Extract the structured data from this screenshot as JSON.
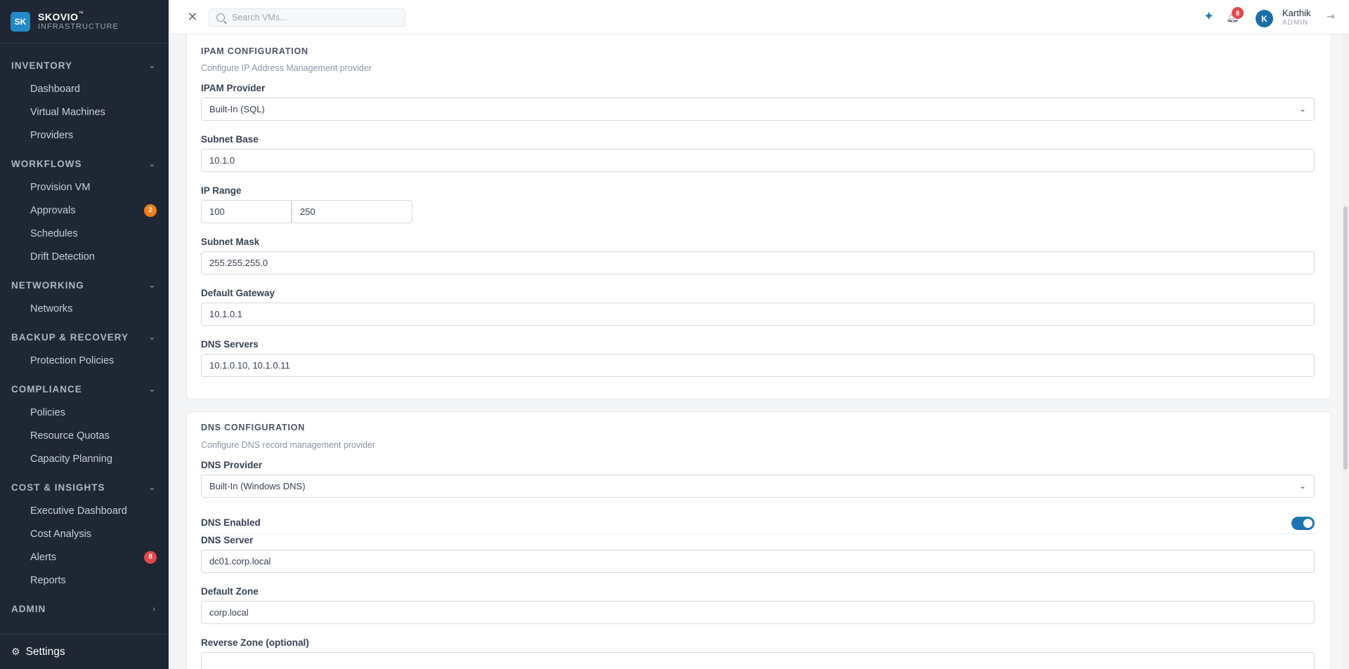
{
  "brand": {
    "logo": "SK",
    "name": "SKOVIO",
    "tm": "™",
    "subtitle": "INFRASTRUCTURE"
  },
  "sidebar": {
    "groups": [
      {
        "label": "INVENTORY",
        "items": [
          {
            "label": "Dashboard"
          },
          {
            "label": "Virtual Machines"
          },
          {
            "label": "Providers"
          }
        ]
      },
      {
        "label": "WORKFLOWS",
        "items": [
          {
            "label": "Provision VM"
          },
          {
            "label": "Approvals",
            "badge": "2"
          },
          {
            "label": "Schedules"
          },
          {
            "label": "Drift Detection"
          }
        ]
      },
      {
        "label": "NETWORKING",
        "items": [
          {
            "label": "Networks"
          }
        ]
      },
      {
        "label": "BACKUP & RECOVERY",
        "items": [
          {
            "label": "Protection Policies"
          }
        ]
      },
      {
        "label": "COMPLIANCE",
        "items": [
          {
            "label": "Policies"
          },
          {
            "label": "Resource Quotas"
          },
          {
            "label": "Capacity Planning"
          }
        ]
      },
      {
        "label": "COST & INSIGHTS",
        "items": [
          {
            "label": "Executive Dashboard"
          },
          {
            "label": "Cost Analysis"
          },
          {
            "label": "Alerts",
            "badge": "8"
          },
          {
            "label": "Reports"
          }
        ]
      },
      {
        "label": "ADMIN",
        "items": []
      }
    ],
    "settings_label": "Settings"
  },
  "topbar": {
    "search_placeholder": "Search VMs...",
    "notification_count": "8",
    "user": {
      "initial": "K",
      "name": "Karthik",
      "role": "ADMIN"
    }
  },
  "ipam": {
    "title": "IPAM CONFIGURATION",
    "description": "Configure IP Address Management provider",
    "provider_label": "IPAM Provider",
    "provider_value": "Built-In (SQL)",
    "subnet_base_label": "Subnet Base",
    "subnet_base_value": "10.1.0",
    "ip_range_label": "IP Range",
    "ip_range_start": "100",
    "ip_range_end": "250",
    "subnet_mask_label": "Subnet Mask",
    "subnet_mask_value": "255.255.255.0",
    "gateway_label": "Default Gateway",
    "gateway_value": "10.1.0.1",
    "dns_servers_label": "DNS Servers",
    "dns_servers_value": "10.1.0.10, 10.1.0.11"
  },
  "dns": {
    "title": "DNS CONFIGURATION",
    "description": "Configure DNS record management provider",
    "provider_label": "DNS Provider",
    "provider_value": "Built-In (Windows DNS)",
    "enabled_label": "DNS Enabled",
    "enabled": true,
    "server_label": "DNS Server",
    "server_value": "dc01.corp.local",
    "zone_label": "Default Zone",
    "zone_value": "corp.local",
    "reverse_zone_label": "Reverse Zone (optional)"
  },
  "colors": {
    "sidebar_bg": "#1e2733",
    "accent": "#1a76b3",
    "badge_orange": "#f07f1c",
    "badge_red": "#e5484d"
  }
}
